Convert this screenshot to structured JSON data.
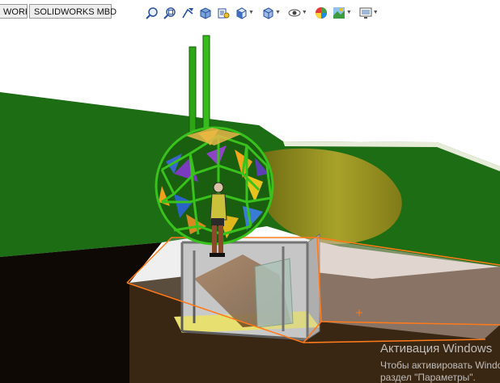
{
  "tabs": [
    {
      "label": "WORKS"
    },
    {
      "label": "SOLIDWORKS MBD"
    }
  ],
  "heads_up_toolbar": [
    {
      "icon": "zoom-to-fit-icon"
    },
    {
      "icon": "zoom-to-area-icon"
    },
    {
      "icon": "previous-view-icon"
    },
    {
      "icon": "section-view-icon"
    },
    {
      "icon": "dynamic-annotation-icon"
    },
    {
      "icon": "view-orientation-icon",
      "dropdown": true
    },
    {
      "icon": "display-style-icon",
      "dropdown": true
    },
    {
      "icon": "hide-show-items-icon",
      "dropdown": true
    },
    {
      "icon": "edit-appearance-icon"
    },
    {
      "icon": "apply-scene-icon",
      "dropdown": true
    },
    {
      "icon": "view-settings-icon",
      "dropdown": true
    }
  ],
  "colors": {
    "ground": "#1c6b14",
    "soil": "#3a2612",
    "pipes": "#33b21c",
    "pit_glass": "#bcbcbc",
    "selection_edge": "#ff7a1a",
    "mound": "#9c961f"
  },
  "watermark": {
    "line1": "Активация Windows",
    "line2": "Чтобы активировать Windo",
    "line3": "раздел \"Параметры\"."
  }
}
